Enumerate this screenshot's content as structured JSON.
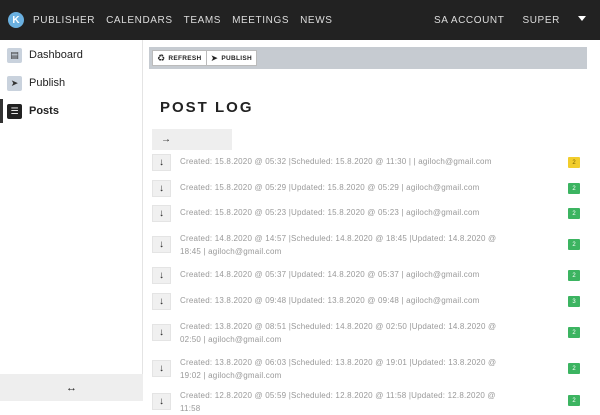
{
  "topbar": {
    "logo_letter": "K",
    "nav": [
      "PUBLISHER",
      "CALENDARS",
      "TEAMS",
      "MEETINGS",
      "NEWS"
    ],
    "right_nav": [
      "SA ACCOUNT",
      "SUPER"
    ]
  },
  "sidebar": {
    "items": [
      {
        "label": "Dashboard",
        "icon": "chart-icon",
        "glyph": "▤"
      },
      {
        "label": "Publish",
        "icon": "send-icon",
        "glyph": "➤"
      },
      {
        "label": "Posts",
        "icon": "list-icon",
        "glyph": "☰"
      }
    ],
    "active": "Posts",
    "footer_glyph": "↔"
  },
  "toolbar": {
    "refresh_label": "REFRESH",
    "publish_label": "PUBLISH"
  },
  "page": {
    "title": "POST LOG",
    "arrow_glyph": "→"
  },
  "posts": [
    {
      "text": "Created: 15.8.2020 @ 05:32   |Scheduled: 15.8.2020 @ 11:30   |   |   agiloch@gmail.com",
      "badge": "2",
      "badge_color": "#f2cd2c"
    },
    {
      "text": "Created: 15.8.2020 @ 05:29   |Updated: 15.8.2020 @ 05:29   |   agiloch@gmail.com",
      "badge": "2",
      "badge_color": "#3cb461"
    },
    {
      "text": "Created: 15.8.2020 @ 05:23   |Updated: 15.8.2020 @ 05:23   |   agiloch@gmail.com",
      "badge": "2",
      "badge_color": "#3cb461"
    },
    {
      "text": "Created: 14.8.2020 @ 14:57   |Scheduled: 14.8.2020 @ 18:45   |Updated: 14.8.2020 @ 18:45   |   agiloch@gmail.com",
      "badge": "2",
      "badge_color": "#3cb461"
    },
    {
      "text": "Created: 14.8.2020 @ 05:37   |Updated: 14.8.2020 @ 05:37   |   agiloch@gmail.com",
      "badge": "2",
      "badge_color": "#3cb461"
    },
    {
      "text": "Created: 13.8.2020 @ 09:48   |Updated: 13.8.2020 @ 09:48   |   agiloch@gmail.com",
      "badge": "3",
      "badge_color": "#3cb461"
    },
    {
      "text": "Created: 13.8.2020 @ 08:51   |Scheduled: 14.8.2020 @ 02:50   |Updated: 14.8.2020 @ 02:50   |   agiloch@gmail.com",
      "badge": "2",
      "badge_color": "#3cb461"
    },
    {
      "text": "Created: 13.8.2020 @ 06:03   |Scheduled: 13.8.2020 @ 19:01   |Updated: 13.8.2020 @ 19:02   |   agiloch@gmail.com",
      "badge": "2",
      "badge_color": "#3cb461"
    },
    {
      "text": "Created: 12.8.2020 @ 05:59   |Scheduled: 12.8.2020 @ 11:58   |Updated: 12.8.2020 @ 11:58",
      "badge": "2",
      "badge_color": "#3cb461"
    }
  ],
  "row_arrow_glyph": "↓"
}
